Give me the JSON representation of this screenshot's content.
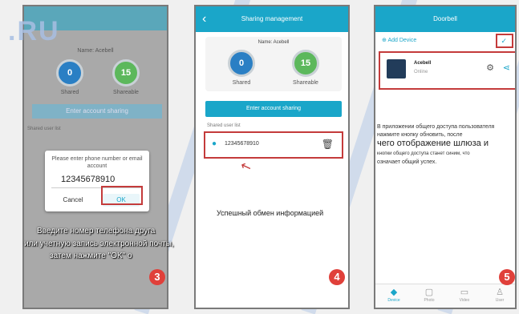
{
  "watermark": ".RU",
  "phone3": {
    "name_label": "Name: Acebell",
    "shared_count": "0",
    "shared_label": "Shared",
    "shareable_count": "15",
    "shareable_label": "Shareable",
    "button_label": "Enter account sharing",
    "shared_user_list": "Shared user list",
    "dialog_prompt": "Please enter phone number or email account",
    "dialog_value": "12345678910",
    "cancel_label": "Cancel",
    "ok_label": "OK",
    "caption_1": "Введите номер телефона друга",
    "caption_2": "или учетную запись электронной почты,",
    "caption_3": "затем нажмите \"OK\" о",
    "step": "3"
  },
  "phone4": {
    "title": "Sharing management",
    "name_label": "Name: Acebell",
    "shared_count": "0",
    "shared_label": "Shared",
    "shareable_count": "15",
    "shareable_label": "Shareable",
    "button_label": "Enter account sharing",
    "shared_user_list": "Shared user list",
    "user_number": "12345678910",
    "caption": "Успешный обмен информацией",
    "step": "4"
  },
  "phone5": {
    "title": "Doorbell",
    "add_device": "Add Device",
    "device_name": "Acebell",
    "device_status": "Online",
    "caption_1": "В приложении общего доступа пользователя",
    "caption_2": "нажмите кнопку обновить, после",
    "caption_3": "чего отображение шлюза и",
    "caption_4": "кнопки общего доступа станет синим, что",
    "caption_5": "означает общий успех.",
    "tabs": [
      "Device",
      "Photo",
      "Video",
      "User"
    ],
    "step": "5"
  },
  "colors": {
    "accent": "#1aa6c9",
    "highlight": "#c43b3b",
    "step_badge": "#e0403a"
  }
}
